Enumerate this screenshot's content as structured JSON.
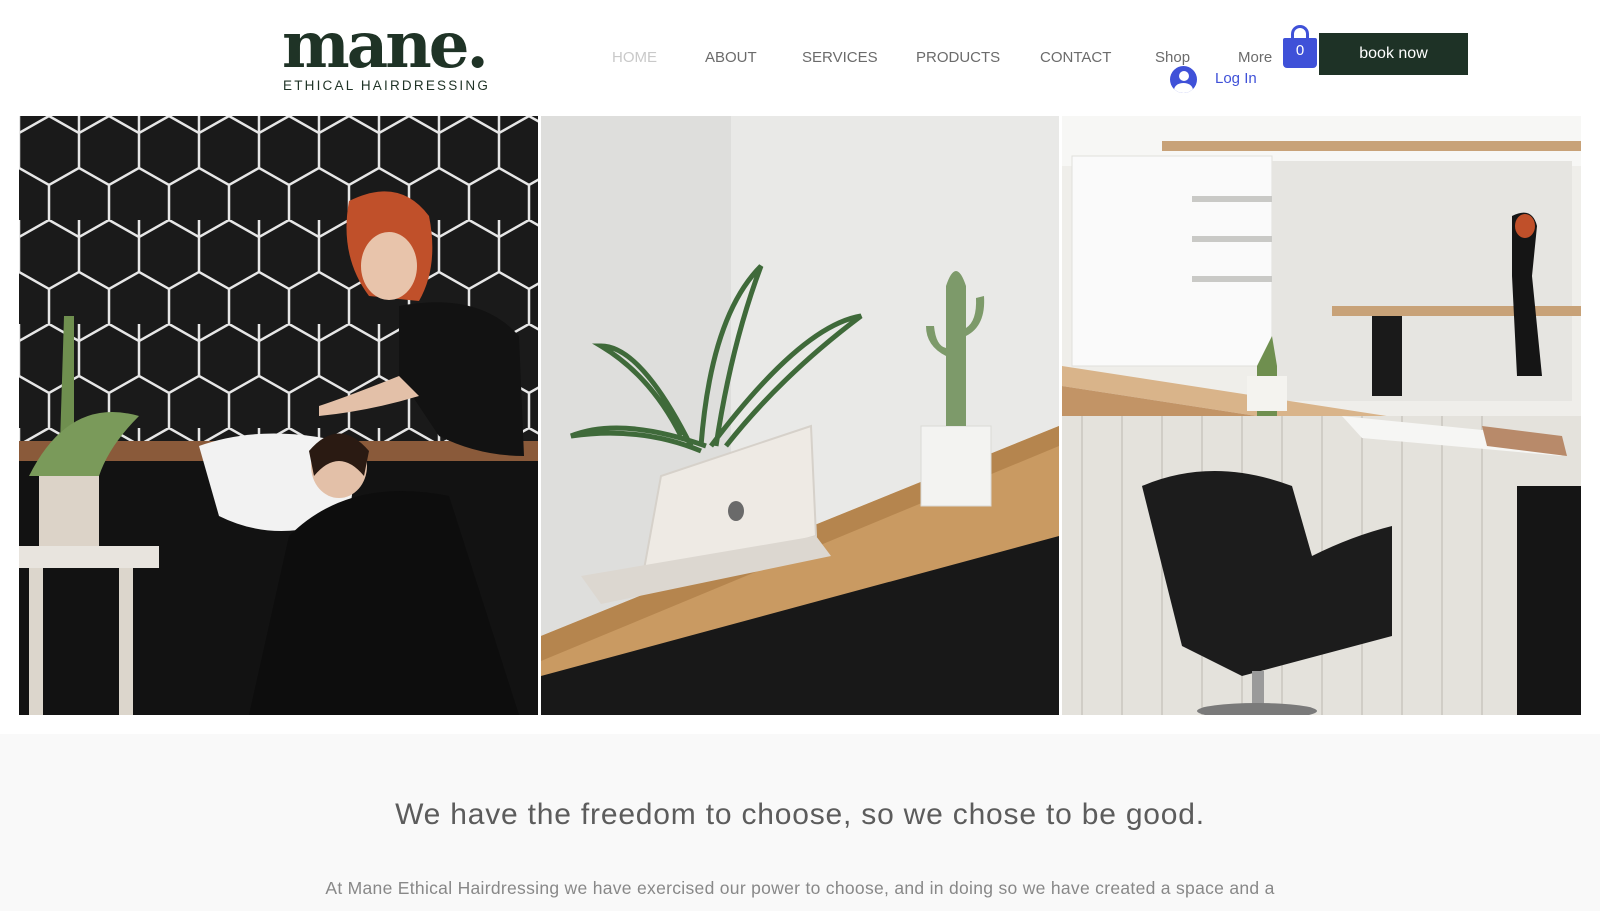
{
  "brand": {
    "wordmark": "mane.",
    "tagline": "ETHICAL HAIRDRESSING",
    "color": "#1f3326"
  },
  "nav": {
    "items": [
      {
        "label": "HOME",
        "active": true
      },
      {
        "label": "ABOUT"
      },
      {
        "label": "SERVICES"
      },
      {
        "label": "PRODUCTS"
      },
      {
        "label": "CONTACT"
      },
      {
        "label": "Shop"
      },
      {
        "label": "More"
      }
    ]
  },
  "account": {
    "login_label": "Log In",
    "icon": "user-avatar-icon",
    "color": "#3f51d8"
  },
  "cart": {
    "count": "0",
    "icon": "shopping-bag-icon"
  },
  "cta": {
    "book_label": "book now",
    "color": "#1e3226"
  },
  "gallery": {
    "images": [
      {
        "subject": "stylist washing client hair at basin",
        "icon": "salon-photo"
      },
      {
        "subject": "laptop and plants on wooden desk",
        "icon": "desk-photo"
      },
      {
        "subject": "salon interior with styling chairs",
        "icon": "salon-interior-photo"
      }
    ]
  },
  "intro": {
    "heading": "We have the freedom to choose, so we chose to be good.",
    "body": "At Mane Ethical Hairdressing we have exercised our power to choose, and in doing so we have created a space and a"
  }
}
